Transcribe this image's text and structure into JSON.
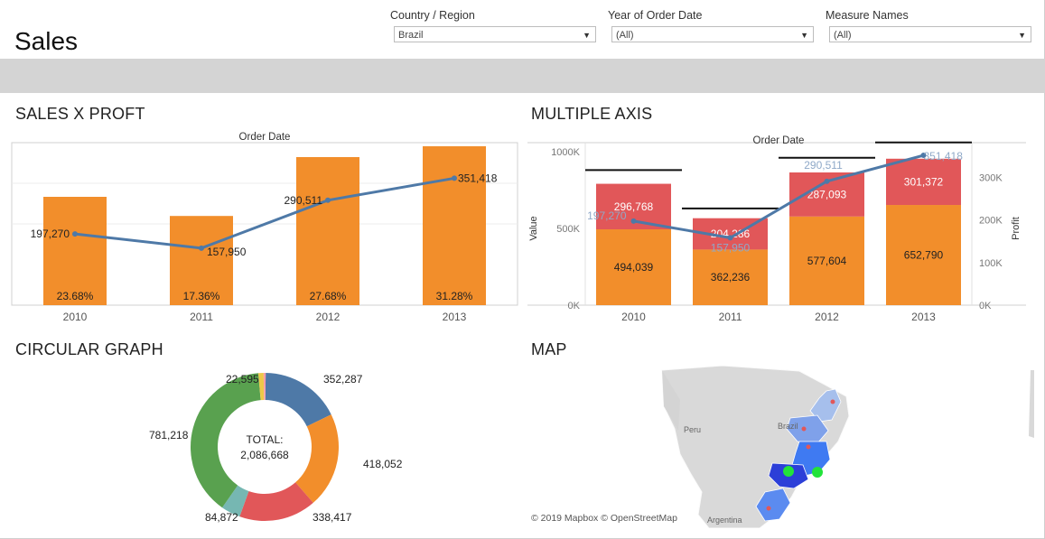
{
  "app": {
    "title": "Sales"
  },
  "filters": [
    {
      "label": "Country / Region",
      "value": "Brazil"
    },
    {
      "label": "Year of Order Date",
      "value": "(All)"
    },
    {
      "label": "Measure Names",
      "value": "(All)"
    }
  ],
  "panels": {
    "sales_profit": "SALES X PROFT",
    "multiple_axis": "MULTIPLE AXIS",
    "circular": "CIRCULAR GRAPH",
    "map": "MAP"
  },
  "colors": {
    "orange": "#f28e2b",
    "red": "#e15759",
    "blue": "#4e79a7",
    "green": "#59a14f",
    "teal": "#76b7b2",
    "yellow": "#edc948",
    "pink": "#ff9da7"
  },
  "chart_data": [
    {
      "type": "bar",
      "panel": "sales_profit",
      "title": "Order Date",
      "categories": [
        "2010",
        "2011",
        "2012",
        "2013"
      ],
      "series": [
        {
          "values": [
            300000,
            247000,
            410000,
            440000
          ]
        },
        {
          "values": [
            197270,
            157950,
            290511,
            351418
          ],
          "labels": [
            "197,270",
            "157,950",
            "290,511",
            "351,418"
          ]
        }
      ],
      "bar_labels": [
        "23.68%",
        "17.36%",
        "27.68%",
        "31.28%"
      ],
      "ylim": [
        0,
        450000
      ]
    },
    {
      "type": "bar",
      "panel": "multiple_axis",
      "title": "Order Date",
      "ylabel": "Value",
      "y2label": "Profit",
      "y_ticks": [
        "1000K",
        "500K",
        "0K"
      ],
      "y2_ticks": [
        "300K",
        "200K",
        "100K",
        "0K"
      ],
      "categories": [
        "2010",
        "2011",
        "2012",
        "2013"
      ],
      "series": [
        {
          "values": [
            494039,
            362236,
            577604,
            652790
          ],
          "labels": [
            "494,039",
            "362,236",
            "577,604",
            "652,790"
          ]
        },
        {
          "values": [
            296768,
            204286,
            287093,
            301372
          ],
          "labels": [
            "296,768",
            "204,286",
            "287,093",
            "301,372"
          ]
        },
        {
          "values": [
            197270,
            157950,
            290511,
            351418
          ],
          "labels": [
            "197,270",
            "157,950",
            "290,511",
            "351,418"
          ]
        }
      ],
      "target_lines": [
        880000,
        630000,
        960000,
        1060000
      ],
      "ylim": [
        0,
        1000000
      ],
      "y2lim": [
        0,
        360000
      ]
    },
    {
      "type": "pie",
      "panel": "circular",
      "center_text": [
        "TOTAL:",
        "2,086,668"
      ],
      "slices": [
        {
          "value": 352287,
          "label": "352,287"
        },
        {
          "value": 418052,
          "label": "418,052"
        },
        {
          "value": 338417,
          "label": "338,417"
        },
        {
          "value": 84872,
          "label": "84,872"
        },
        {
          "value": 781218,
          "label": "781,218"
        },
        {
          "value": 22595,
          "label": "22,595"
        },
        {
          "value": 9000,
          "label": ""
        }
      ]
    }
  ],
  "map": {
    "labels": [
      "Brazil",
      "Peru",
      "Argentina"
    ],
    "attribution": "© 2019 Mapbox © OpenStreetMap"
  }
}
